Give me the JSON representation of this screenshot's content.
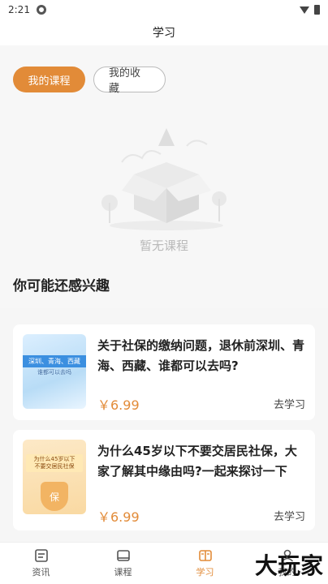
{
  "status": {
    "time": "2:21"
  },
  "header": {
    "title": "学习"
  },
  "tabs": [
    {
      "label": "我的课程",
      "active": true
    },
    {
      "label": "我的收藏",
      "active": false
    }
  ],
  "empty": {
    "text": "暂无课程"
  },
  "section": {
    "title": "你可能还感兴趣"
  },
  "cards": [
    {
      "title": "关于社保的缴纳问题，退休前深圳、青海、西藏、谁都可以去吗?",
      "price": "￥6.99",
      "button": "去学习",
      "thumb_title": "深圳、青海、西藏",
      "thumb_sub": "谁都可以去吗"
    },
    {
      "title": "为什么45岁以下不要交居民社保，大家了解其中缘由吗?一起来探讨一下",
      "price": "￥6.99",
      "button": "去学习",
      "thumb_line1": "为什么45岁以下",
      "thumb_line2": "不要交居民社保",
      "thumb_badge": "保"
    }
  ],
  "nav": [
    {
      "label": "资讯",
      "icon": "news-icon",
      "active": false
    },
    {
      "label": "课程",
      "icon": "book-icon",
      "active": false
    },
    {
      "label": "学习",
      "icon": "study-icon",
      "active": true
    },
    {
      "label": "我的",
      "icon": "user-icon",
      "active": false
    }
  ],
  "watermark": "大玩家",
  "colors": {
    "accent": "#e28b38"
  }
}
